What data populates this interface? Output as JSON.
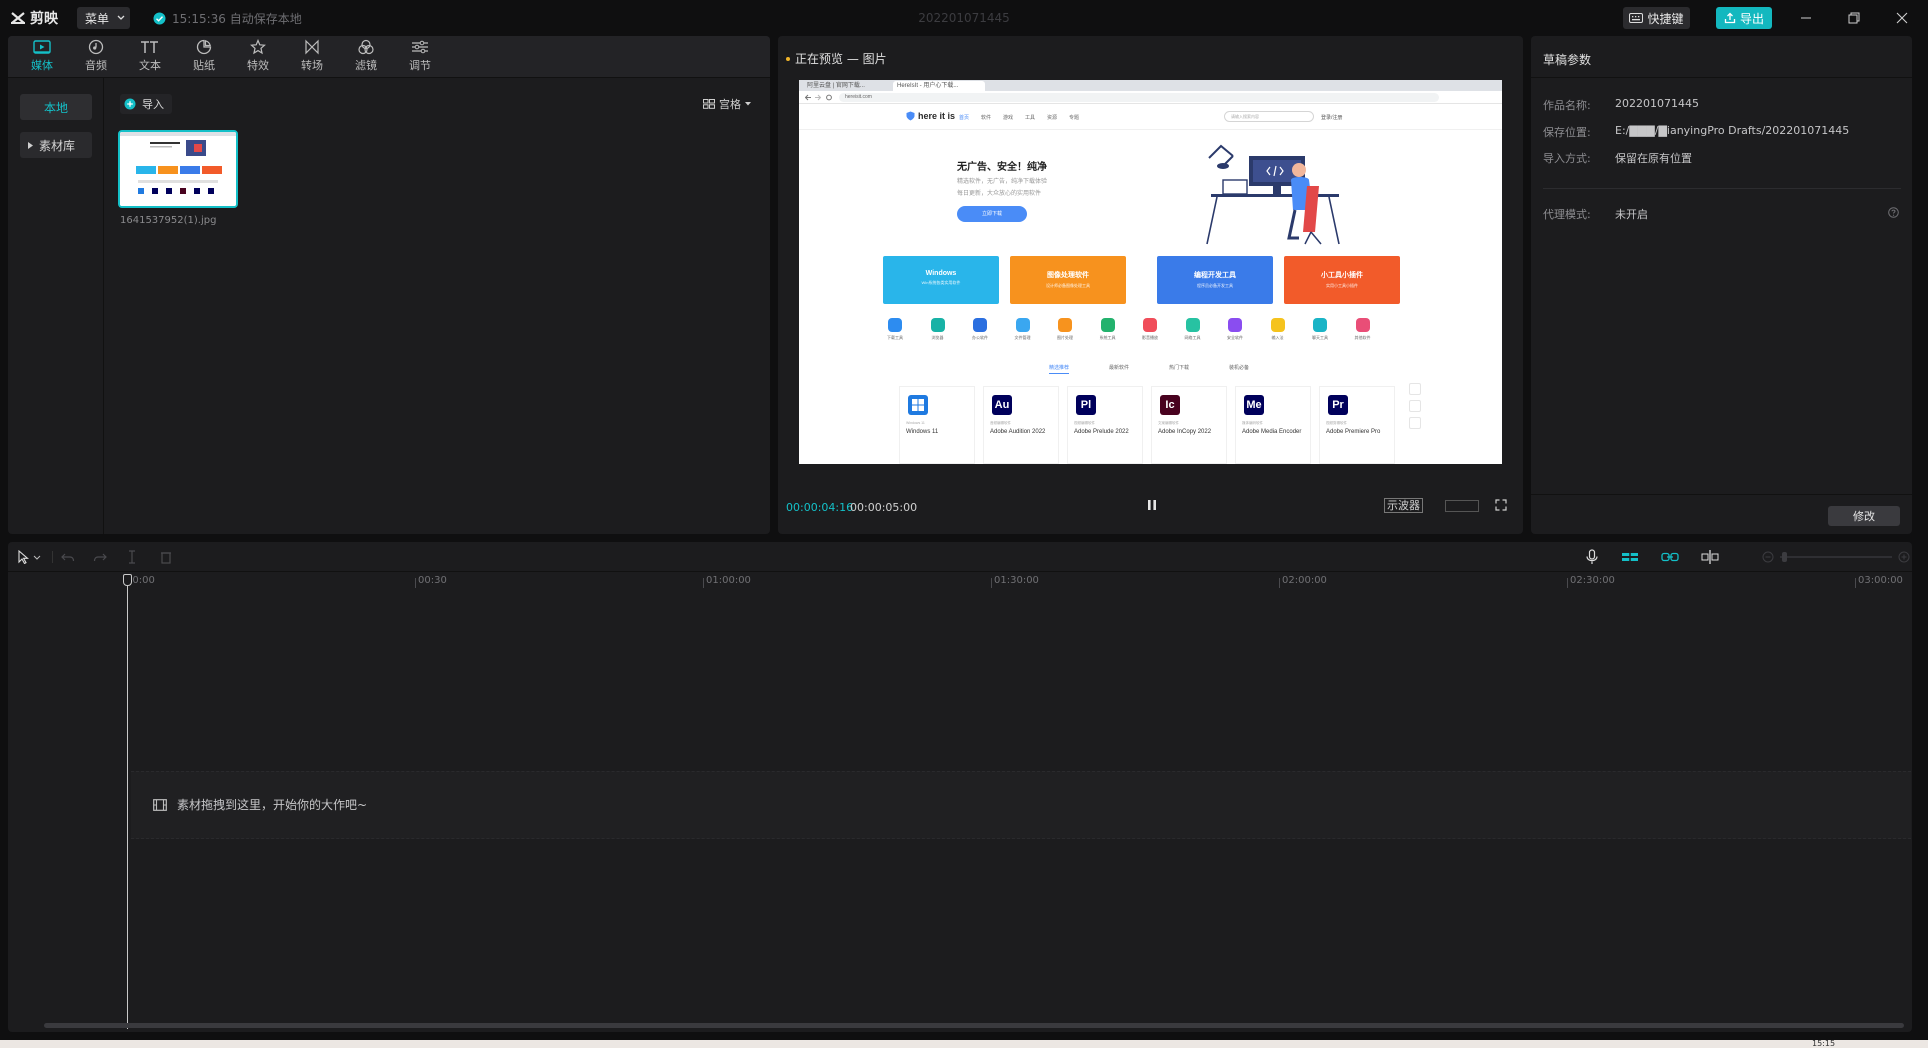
{
  "app": {
    "name": "剪映",
    "menu_label": "菜单",
    "autosave_text": "15:15:36 自动保存本地",
    "doc_title": "202201071445",
    "shortcut_label": "快捷键",
    "export_label": "导出"
  },
  "media_tabs": [
    {
      "label": "媒体",
      "icon": "media-icon",
      "active": true
    },
    {
      "label": "音频",
      "icon": "audio-icon",
      "active": false
    },
    {
      "label": "文本",
      "icon": "text-icon",
      "active": false
    },
    {
      "label": "贴纸",
      "icon": "sticker-icon",
      "active": false
    },
    {
      "label": "特效",
      "icon": "effects-icon",
      "active": false
    },
    {
      "label": "转场",
      "icon": "transition-icon",
      "active": false
    },
    {
      "label": "滤镜",
      "icon": "filter-icon",
      "active": false
    },
    {
      "label": "调节",
      "icon": "adjust-icon",
      "active": false
    }
  ],
  "media_sidebar": {
    "local": "本地",
    "library": "素材库"
  },
  "media_panel": {
    "import_label": "导入",
    "view_label": "宫格",
    "items": [
      {
        "filename": "1641537952(1).jpg"
      }
    ]
  },
  "preview": {
    "title": "正在预览 — 图片",
    "time_current": "00:00:04:16",
    "time_total": "00:00:05:00",
    "scope_label": "示波器"
  },
  "preview_site": {
    "tab1": "阿里云盘 | 官网下载...",
    "tab2": "HereIsIt - 用户心下载...",
    "url": "hereisit.com",
    "brand": "here it is",
    "nav": [
      "首页",
      "软件",
      "游戏",
      "工具",
      "资源",
      "专题"
    ],
    "search_placeholder": "请输入搜索内容",
    "login": "登录/注册",
    "hero_title": "无广告、安全！纯净",
    "hero_sub1": "精选软件，无广告，纯净下载体验",
    "hero_sub2": "每日更新，大众放心的实用软件",
    "hero_button": "立即下载",
    "cards": [
      {
        "title": "Windows",
        "subtitle": "Win系统各类实用软件",
        "color": "#29b5ea"
      },
      {
        "title": "图像处理软件",
        "subtitle": "设计师必备图像处理工具",
        "color": "#f7921e"
      },
      {
        "title": "编程开发工具",
        "subtitle": "程序员必备开发工具",
        "color": "#3a7be9"
      },
      {
        "title": "小工具小插件",
        "subtitle": "实用小工具小插件",
        "color": "#f25b2a"
      }
    ],
    "apps": [
      {
        "label": "下载工具",
        "color": "#2d8cf0"
      },
      {
        "label": "浏览器",
        "color": "#18b2a6"
      },
      {
        "label": "办公软件",
        "color": "#2b6fe0"
      },
      {
        "label": "文件管理",
        "color": "#3aa7f0"
      },
      {
        "label": "图片处理",
        "color": "#f7931e"
      },
      {
        "label": "系统工具",
        "color": "#23b26d"
      },
      {
        "label": "影音播放",
        "color": "#f04d5a"
      },
      {
        "label": "网络工具",
        "color": "#27c2a2"
      },
      {
        "label": "安全软件",
        "color": "#8a4df0"
      },
      {
        "label": "输入法",
        "color": "#f5c31d"
      },
      {
        "label": "聊天工具",
        "color": "#1ab4c6"
      },
      {
        "label": "其他软件",
        "color": "#e94e77"
      }
    ],
    "tabs": [
      "精选推荐",
      "最新软件",
      "热门下载",
      "装机必备"
    ],
    "products": [
      {
        "abbr": "",
        "name": "Windows 11",
        "sub": "Windows 11",
        "color": "#1f7ae0"
      },
      {
        "abbr": "Au",
        "name": "Adobe Audition 2022",
        "sub": "音频编辑软件",
        "color": "#00005b"
      },
      {
        "abbr": "Pl",
        "name": "Adobe Prelude 2022",
        "sub": "视频编辑软件",
        "color": "#00005b"
      },
      {
        "abbr": "Ic",
        "name": "Adobe InCopy 2022",
        "sub": "文案编辑软件",
        "color": "#49021f"
      },
      {
        "abbr": "Me",
        "name": "Adobe Media Encoder",
        "sub": "媒体编码软件",
        "color": "#00005b"
      },
      {
        "abbr": "Pr",
        "name": "Adobe Premiere Pro",
        "sub": "视频剪辑软件",
        "color": "#00005b"
      }
    ]
  },
  "props": {
    "title": "草稿参数",
    "name_label": "作品名称:",
    "name_value": "202201071445",
    "path_label": "保存位置:",
    "path_value": "E:/▇▇▇/▇ianyingPro Drafts/202201071445",
    "import_label": "导入方式:",
    "import_value": "保留在原有位置",
    "proxy_label": "代理模式:",
    "proxy_value": "未开启",
    "modify_label": "修改"
  },
  "timeline": {
    "ticks": [
      "00:00",
      "00:30",
      "01:00:00",
      "01:30:00",
      "02:00:00",
      "02:30:00",
      "03:00:00"
    ],
    "drop_hint": "素材拖拽到这里，开始你的大作吧~"
  },
  "taskbar": {
    "clock": "15:15"
  }
}
